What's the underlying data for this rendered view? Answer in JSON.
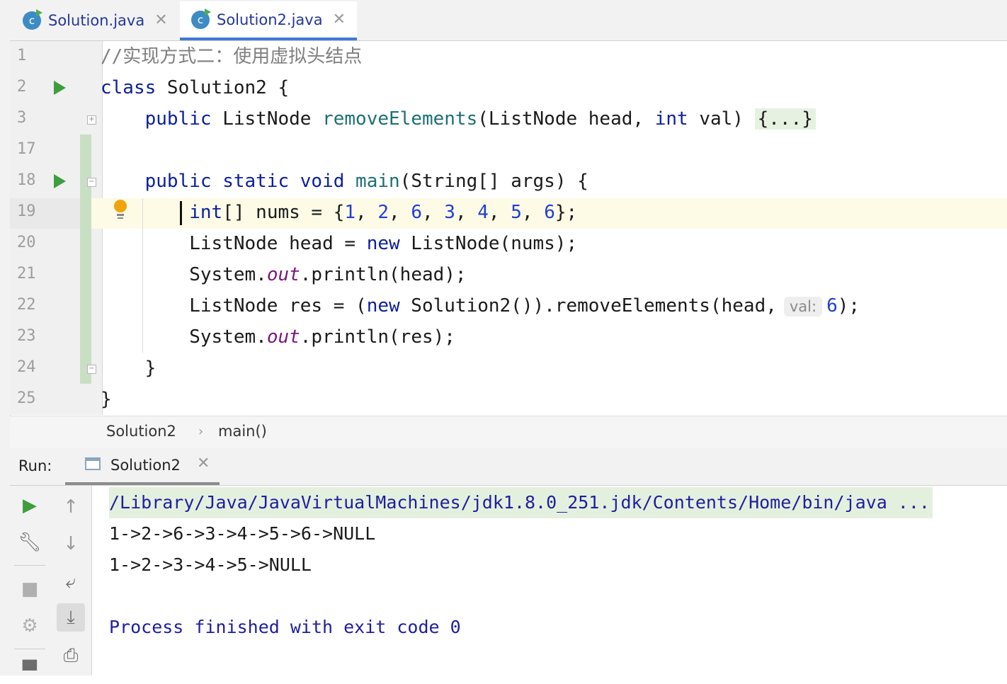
{
  "tabs": [
    {
      "label": "Solution.java",
      "icon": "class-icon",
      "active": false
    },
    {
      "label": "Solution2.java",
      "icon": "class-icon",
      "active": true
    }
  ],
  "editor": {
    "line_numbers": [
      "1",
      "2",
      "3",
      "17",
      "18",
      "19",
      "20",
      "21",
      "22",
      "23",
      "24",
      "25"
    ],
    "lines": {
      "l1_comment": "//实现方式二：使用虚拟头结点",
      "l2_kw": "class",
      "l2_rest": " Solution2 {",
      "l3_kw": "public",
      "l3_type": " ListNode ",
      "l3_fn": "removeElements",
      "l3_params1": "(ListNode head, ",
      "l3_kw2": "int",
      "l3_params2": " val) ",
      "l3_folded": "{...}",
      "l18_kw": "public static void",
      "l18_fn": " main",
      "l18_rest": "(String[] args) {",
      "l19_kw": "int",
      "l19_a": "[] nums = {",
      "l19_n1": "1",
      "l19_n2": "2",
      "l19_n3": "6",
      "l19_n4": "3",
      "l19_n5": "4",
      "l19_n6": "5",
      "l19_n7": "6",
      "l19_end": "};",
      "l20_a": "ListNode head = ",
      "l20_kw": "new",
      "l20_b": " ListNode(nums);",
      "l21_a": "System.",
      "l21_fld": "out",
      "l21_b": ".println(head);",
      "l22_a": "ListNode res = (",
      "l22_kw": "new",
      "l22_b": " Solution2()).removeElements(head,",
      "l22_hint": "val:",
      "l22_num": "6",
      "l22_end": ");",
      "l23_a": "System.",
      "l23_fld": "out",
      "l23_b": ".println(res);",
      "l24": "}",
      "l25": "}"
    }
  },
  "breadcrumb": {
    "class": "Solution2",
    "method": "main()"
  },
  "run": {
    "label": "Run:",
    "tab_label": "Solution2",
    "output": [
      "/Library/Java/JavaVirtualMachines/jdk1.8.0_251.jdk/Contents/Home/bin/java ...",
      "1->2->6->3->4->5->6->NULL",
      "1->2->3->4->5->NULL",
      "Process finished with exit code 0"
    ]
  },
  "colors": {
    "keyword": "#0b1f9e",
    "number": "#1f3fd6",
    "method": "#1c6f76",
    "field": "#7b1680",
    "comment": "#7f7f7f",
    "run_green": "#3c9e3c",
    "tab_accent": "#3e7ad5"
  }
}
